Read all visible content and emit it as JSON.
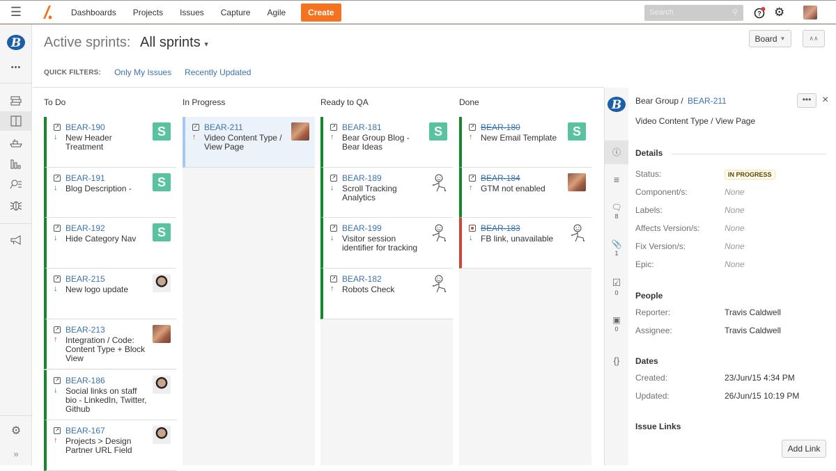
{
  "topbar": {
    "nav": [
      "Dashboards",
      "Projects",
      "Issues",
      "Capture",
      "Agile"
    ],
    "create_label": "Create",
    "search_placeholder": "Search",
    "colors": {
      "accent": "#f57320",
      "link": "#3b73af"
    }
  },
  "leftnav": {
    "icons": [
      "project-logo",
      "more",
      "backlog",
      "active-sprints",
      "releases",
      "reports",
      "issues",
      "components",
      "feedback"
    ],
    "more_label": "•••",
    "bottom": {
      "settings": "gear",
      "expand": "»"
    }
  },
  "header": {
    "title_prefix": "Active sprints:",
    "sprint_selector": "All sprints",
    "quick_filters_label": "QUICK FILTERS:",
    "quick_filters": [
      "Only My Issues",
      "Recently Updated"
    ],
    "board_button": "Board",
    "collapse_label": "«"
  },
  "columns": [
    {
      "name": "To Do",
      "cards": [
        {
          "key": "BEAR-190",
          "summary": "New Header Treatment",
          "priority": "down",
          "type": "story",
          "avatar": "S",
          "done": false
        },
        {
          "key": "BEAR-191",
          "summary": "Blog Description -",
          "priority": "down",
          "type": "story",
          "avatar": "S",
          "done": false
        },
        {
          "key": "BEAR-192",
          "summary": "Hide Category Nav",
          "priority": "down",
          "type": "story",
          "avatar": "S",
          "done": false
        },
        {
          "key": "BEAR-215",
          "summary": "New logo update",
          "priority": "down",
          "type": "story",
          "avatar": "photo-man",
          "done": false
        },
        {
          "key": "BEAR-213",
          "summary": "Integration / Code: Content Type + Block View",
          "priority": "up",
          "type": "story",
          "avatar": "photo-travis",
          "done": false
        },
        {
          "key": "BEAR-186",
          "summary": "Social links on staff bio - LinkedIn, Twitter, Github",
          "priority": "down",
          "type": "story",
          "avatar": "photo-man",
          "done": false
        },
        {
          "key": "BEAR-167",
          "summary": "Projects > Design Partner URL Field",
          "priority": "up",
          "type": "story",
          "avatar": "photo-man",
          "done": false
        }
      ]
    },
    {
      "name": "In Progress",
      "cards": [
        {
          "key": "BEAR-211",
          "summary": "Video Content Type / View Page",
          "priority": "up",
          "type": "task",
          "avatar": "photo-travis",
          "done": false,
          "selected": true
        }
      ]
    },
    {
      "name": "Ready to QA",
      "cards": [
        {
          "key": "BEAR-181",
          "summary": "Bear Group Blog - Bear Ideas",
          "priority": "up",
          "type": "story",
          "avatar": "S",
          "done": false
        },
        {
          "key": "BEAR-189",
          "summary": "Scroll Tracking Analytics",
          "priority": "down",
          "type": "story",
          "avatar": "stick",
          "done": false
        },
        {
          "key": "BEAR-199",
          "summary": "Visitor session identifier for tracking",
          "priority": "down",
          "type": "story",
          "avatar": "stick",
          "done": false
        },
        {
          "key": "BEAR-182",
          "summary": "Robots Check",
          "priority": "up",
          "type": "story",
          "avatar": "stick",
          "done": false
        }
      ]
    },
    {
      "name": "Done",
      "cards": [
        {
          "key": "BEAR-180",
          "summary": "New Email Template",
          "priority": "up",
          "type": "story",
          "avatar": "S",
          "done": true
        },
        {
          "key": "BEAR-184",
          "summary": "GTM not enabled",
          "priority": "up",
          "type": "story",
          "avatar": "photo-travis",
          "done": true
        },
        {
          "key": "BEAR-183",
          "summary": "FB link, unavailable",
          "priority": "down",
          "type": "bug",
          "avatar": "stick",
          "done": true
        }
      ]
    }
  ],
  "detail": {
    "project": "Bear Group /",
    "key": "BEAR-211",
    "summary": "Video Content Type / View Page",
    "more_label": "•••",
    "close_label": "×",
    "side_counts": {
      "comments": "8",
      "attachments": "1",
      "subtasks": "0",
      "screenshots": "0"
    },
    "details_heading": "Details",
    "fields": [
      {
        "label": "Status:",
        "value": "IN PROGRESS",
        "badge": true
      },
      {
        "label": "Component/s:",
        "value": "None"
      },
      {
        "label": "Labels:",
        "value": "None"
      },
      {
        "label": "Affects Version/s:",
        "value": "None"
      },
      {
        "label": "Fix Version/s:",
        "value": "None"
      },
      {
        "label": "Epic:",
        "value": "None"
      }
    ],
    "people_heading": "People",
    "people": [
      {
        "label": "Reporter:",
        "value": "Travis Caldwell"
      },
      {
        "label": "Assignee:",
        "value": "Travis Caldwell"
      }
    ],
    "dates_heading": "Dates",
    "dates": [
      {
        "label": "Created:",
        "value": "23/Jun/15 4:34 PM"
      },
      {
        "label": "Updated:",
        "value": "26/Jun/15 10:19 PM"
      }
    ],
    "links_heading": "Issue Links",
    "add_link_label": "Add Link"
  }
}
